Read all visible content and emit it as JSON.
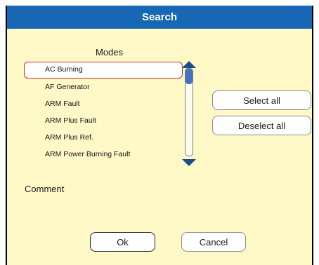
{
  "dialog": {
    "title": "Search"
  },
  "modes": {
    "label": "Modes",
    "items": [
      {
        "label": "AC Burning",
        "selected": true
      },
      {
        "label": "AF Generator",
        "selected": false
      },
      {
        "label": "ARM Fault",
        "selected": false
      },
      {
        "label": "ARM Plus Fault",
        "selected": false
      },
      {
        "label": "ARM Plus Ref.",
        "selected": false
      },
      {
        "label": "ARM Power Burning Fault",
        "selected": false
      }
    ],
    "scroll": {
      "position": 0.0,
      "visible_fraction": 0.18
    }
  },
  "buttons": {
    "select_all": "Select all",
    "deselect_all": "Deselect all",
    "ok": "Ok",
    "cancel": "Cancel"
  },
  "comment": {
    "label": "Comment"
  },
  "colors": {
    "title_bar": "#1767b4",
    "dialog_bg": "#fff9c8",
    "selection_border": "#d42a2a",
    "scroll_accent": "#3e74c4"
  }
}
